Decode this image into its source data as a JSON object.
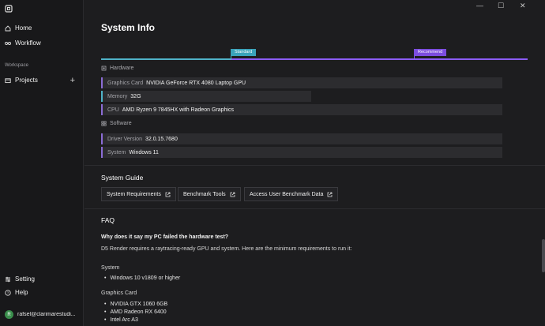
{
  "window": {
    "minimize": "—",
    "maximize": "☐",
    "close": "✕"
  },
  "sidebar": {
    "items": [
      {
        "label": "Home",
        "icon": "home-icon"
      },
      {
        "label": "Workflow",
        "icon": "workflow-icon"
      }
    ],
    "workspace_label": "Workspace",
    "projects_label": "Projects",
    "add_project": "+",
    "bottom": [
      {
        "label": "Setting",
        "icon": "settings-icon"
      },
      {
        "label": "Help",
        "icon": "help-icon"
      }
    ],
    "user": {
      "initial": "R",
      "name": "rafsel@clarimarestudi..."
    }
  },
  "main": {
    "title": "System Info",
    "gauge": {
      "standard_label": "Standard",
      "recommend_label": "Recommend",
      "standard_color": "#4fb3c8",
      "recommend_color": "#8b5cf6"
    },
    "hardware": {
      "heading": "Hardware",
      "rows": [
        {
          "label": "Graphics Card",
          "value": "NVIDIA GeForce RTX 4080 Laptop GPU",
          "color": "#8b6cd6"
        },
        {
          "label": "Memory",
          "value": "32G",
          "color": "#4fb3c8"
        },
        {
          "label": "CPU",
          "value": "AMD Ryzen 9 7845HX with Radeon Graphics",
          "color": "#8b6cd6"
        }
      ]
    },
    "software": {
      "heading": "Software",
      "rows": [
        {
          "label": "Driver Version",
          "value": "32.0.15.7680",
          "color": "#8b6cd6"
        },
        {
          "label": "System",
          "value": "Windows 11",
          "color": "#8b6cd6"
        }
      ]
    },
    "guide": {
      "heading": "System Guide",
      "buttons": [
        "System Requirements",
        "Benchmark Tools",
        "Access User Benchmark Data"
      ]
    },
    "faq": {
      "heading": "FAQ",
      "question": "Why does it say my PC failed the hardware test?",
      "answer": "D5 Render requires a raytracing-ready GPU and system. Here are the minimum requirements to run it:",
      "system_heading": "System",
      "system_items": [
        "Windows 10 v1809 or higher"
      ],
      "gpu_heading": "Graphics Card",
      "gpu_items": [
        "NVIDIA GTX 1060 6GB",
        "AMD Radeon RX 6400",
        "Intel Arc A3"
      ]
    }
  }
}
